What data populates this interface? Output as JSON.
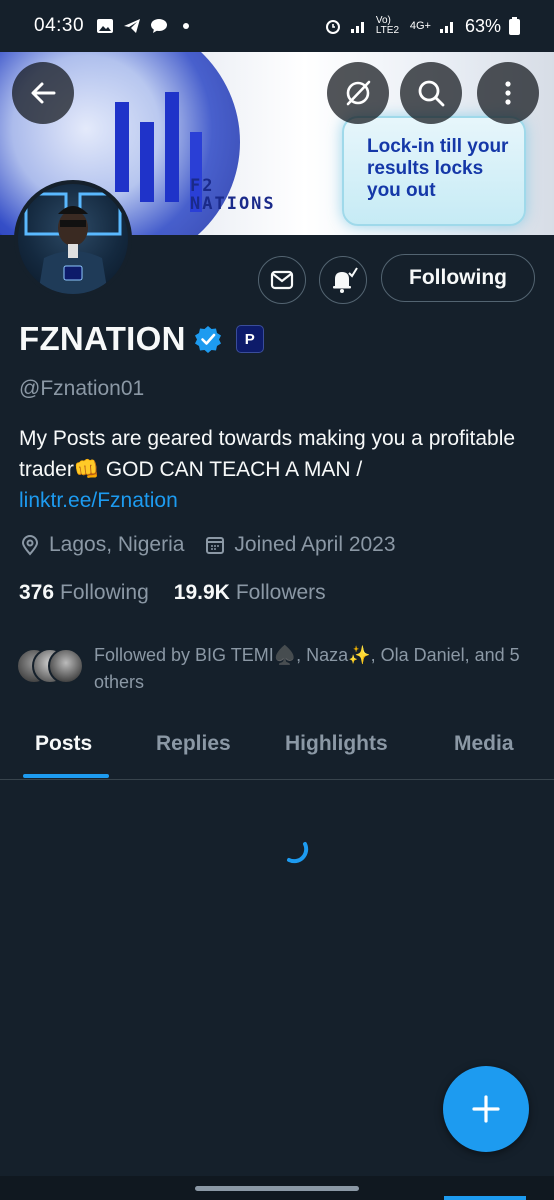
{
  "status_bar": {
    "time": "04:30",
    "network_label": "Vo) LTE2",
    "network_type": "4G+",
    "battery": "63%"
  },
  "banner": {
    "brand_line1": "F2",
    "brand_line2": "NATIONS",
    "promo_text": "Lock-in till your results locks you out"
  },
  "actions": {
    "follow_label": "Following"
  },
  "profile": {
    "display_name": "FZNATION",
    "affiliate_badge": "P",
    "handle": "@Fznation01",
    "bio_text": "My Posts are geared towards making you a profitable trader👊 GOD CAN TEACH A MAN  /",
    "bio_link": "linktr.ee/Fznation",
    "location": "Lagos, Nigeria",
    "joined": "Joined April 2023",
    "following_count": "376",
    "following_label": "Following",
    "followers_count": "19.9K",
    "followers_label": "Followers",
    "followed_by": "Followed by BIG TEMI♠️, Naza✨, Ola Daniel, and 5 others"
  },
  "tabs": [
    {
      "label": "Posts",
      "active": true
    },
    {
      "label": "Replies",
      "active": false
    },
    {
      "label": "Highlights",
      "active": false
    },
    {
      "label": "Media",
      "active": false
    }
  ],
  "colors": {
    "background": "#15202b",
    "accent": "#1d9bf0",
    "secondary_text": "#8b98a5",
    "primary_text": "#f7f9f9"
  },
  "icons": {
    "back": "arrow-left-icon",
    "grok": "grok-icon",
    "search": "search-icon",
    "more": "more-vertical-icon",
    "message": "envelope-icon",
    "notify": "bell-plus-icon",
    "location": "location-pin-icon",
    "calendar": "calendar-icon",
    "compose": "plus-icon"
  }
}
